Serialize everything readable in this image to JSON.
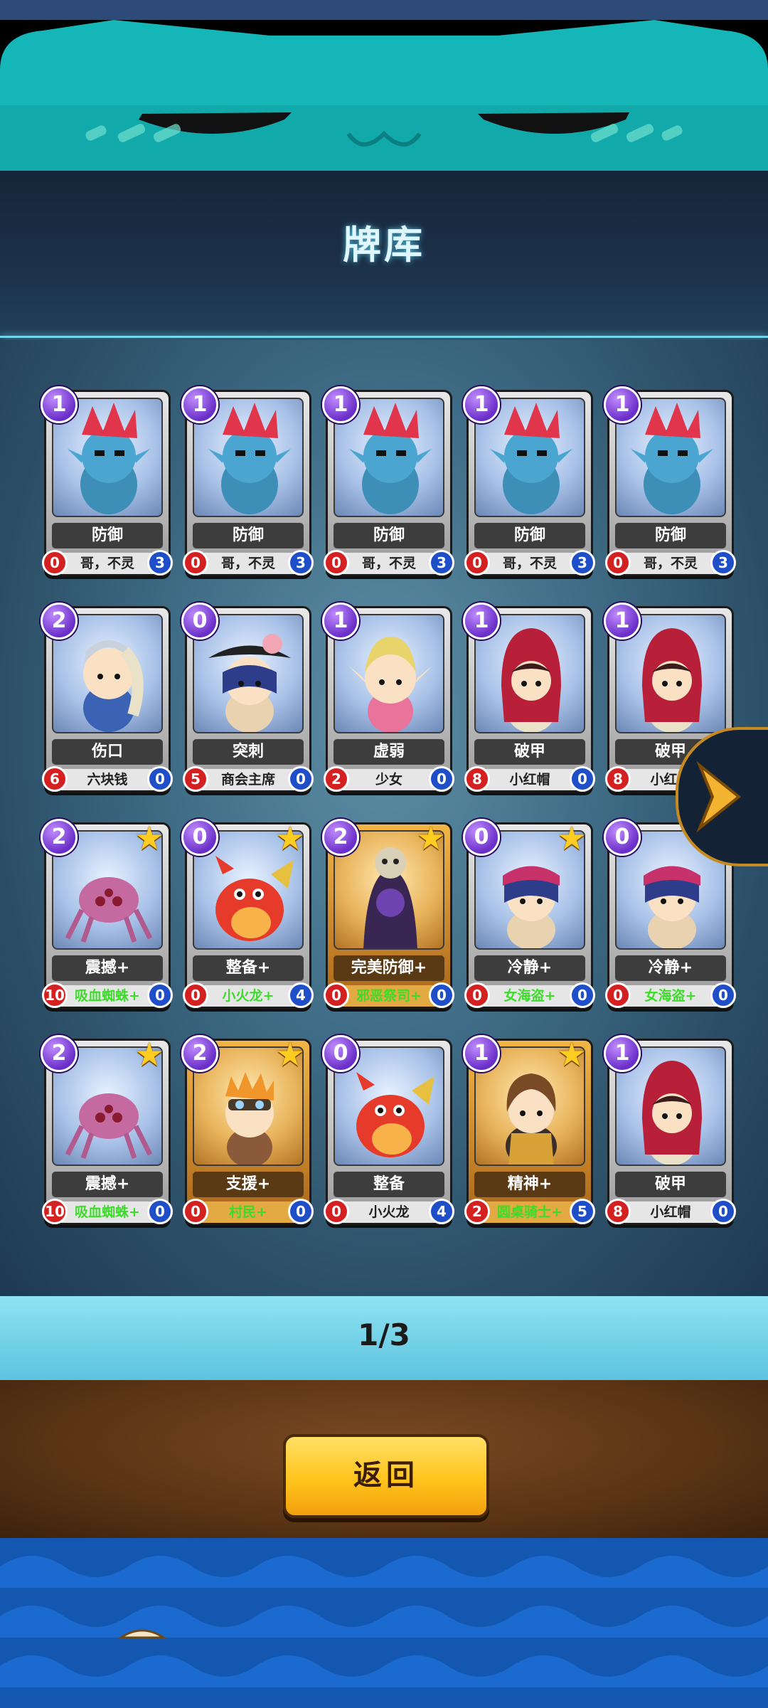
{
  "page": {
    "title": "牌库"
  },
  "pager": {
    "text": "1/3"
  },
  "back": {
    "label": "返回"
  },
  "colors": {
    "cost": "#6a2fc8",
    "atk": "#d42020",
    "hp": "#1f4fc8",
    "accent": "#74d6ea",
    "button": "#ffc41c"
  },
  "cards": [
    {
      "cost": "1",
      "name": "防御",
      "owner": "哥，不灵",
      "atk": "0",
      "hp": "3",
      "star": false,
      "gold": false,
      "green": false,
      "figure": "troll"
    },
    {
      "cost": "1",
      "name": "防御",
      "owner": "哥，不灵",
      "atk": "0",
      "hp": "3",
      "star": false,
      "gold": false,
      "green": false,
      "figure": "troll"
    },
    {
      "cost": "1",
      "name": "防御",
      "owner": "哥，不灵",
      "atk": "0",
      "hp": "3",
      "star": false,
      "gold": false,
      "green": false,
      "figure": "troll"
    },
    {
      "cost": "1",
      "name": "防御",
      "owner": "哥，不灵",
      "atk": "0",
      "hp": "3",
      "star": false,
      "gold": false,
      "green": false,
      "figure": "troll"
    },
    {
      "cost": "1",
      "name": "防御",
      "owner": "哥，不灵",
      "atk": "0",
      "hp": "3",
      "star": false,
      "gold": false,
      "green": false,
      "figure": "troll"
    },
    {
      "cost": "2",
      "name": "伤口",
      "owner": "六块钱",
      "atk": "6",
      "hp": "0",
      "star": false,
      "gold": false,
      "green": false,
      "figure": "knight"
    },
    {
      "cost": "0",
      "name": "突刺",
      "owner": "商会主席",
      "atk": "5",
      "hp": "0",
      "star": false,
      "gold": false,
      "green": false,
      "figure": "pirate"
    },
    {
      "cost": "1",
      "name": "虚弱",
      "owner": "少女",
      "atk": "2",
      "hp": "0",
      "star": false,
      "gold": false,
      "green": false,
      "figure": "elf"
    },
    {
      "cost": "1",
      "name": "破甲",
      "owner": "小红帽",
      "atk": "8",
      "hp": "0",
      "star": false,
      "gold": false,
      "green": false,
      "figure": "redhood"
    },
    {
      "cost": "1",
      "name": "破甲",
      "owner": "小红帽",
      "atk": "8",
      "hp": "0",
      "star": false,
      "gold": false,
      "green": false,
      "figure": "redhood"
    },
    {
      "cost": "2",
      "name": "震撼+",
      "owner": "吸血蜘蛛+",
      "atk": "10",
      "hp": "0",
      "star": true,
      "gold": false,
      "green": true,
      "figure": "spider"
    },
    {
      "cost": "0",
      "name": "整备+",
      "owner": "小火龙+",
      "atk": "0",
      "hp": "4",
      "star": true,
      "gold": false,
      "green": true,
      "figure": "dragon"
    },
    {
      "cost": "2",
      "name": "完美防御+",
      "owner": "邪恶祭司+",
      "atk": "0",
      "hp": "0",
      "star": true,
      "gold": true,
      "green": true,
      "figure": "priest"
    },
    {
      "cost": "0",
      "name": "冷静+",
      "owner": "女海盗+",
      "atk": "0",
      "hp": "0",
      "star": true,
      "gold": false,
      "green": true,
      "figure": "pirategirl"
    },
    {
      "cost": "0",
      "name": "冷静+",
      "owner": "女海盗+",
      "atk": "0",
      "hp": "0",
      "star": true,
      "gold": false,
      "green": true,
      "figure": "pirategirl"
    },
    {
      "cost": "2",
      "name": "震撼+",
      "owner": "吸血蜘蛛+",
      "atk": "10",
      "hp": "0",
      "star": true,
      "gold": false,
      "green": true,
      "figure": "spider"
    },
    {
      "cost": "2",
      "name": "支援+",
      "owner": "村民+",
      "atk": "0",
      "hp": "0",
      "star": true,
      "gold": true,
      "green": true,
      "figure": "villager"
    },
    {
      "cost": "0",
      "name": "整备",
      "owner": "小火龙",
      "atk": "0",
      "hp": "4",
      "star": false,
      "gold": false,
      "green": false,
      "figure": "dragon"
    },
    {
      "cost": "1",
      "name": "精神+",
      "owner": "圆桌骑士+",
      "atk": "2",
      "hp": "5",
      "star": true,
      "gold": true,
      "green": true,
      "figure": "roundknight"
    },
    {
      "cost": "1",
      "name": "破甲",
      "owner": "小红帽",
      "atk": "8",
      "hp": "0",
      "star": false,
      "gold": false,
      "green": false,
      "figure": "redhood"
    }
  ]
}
